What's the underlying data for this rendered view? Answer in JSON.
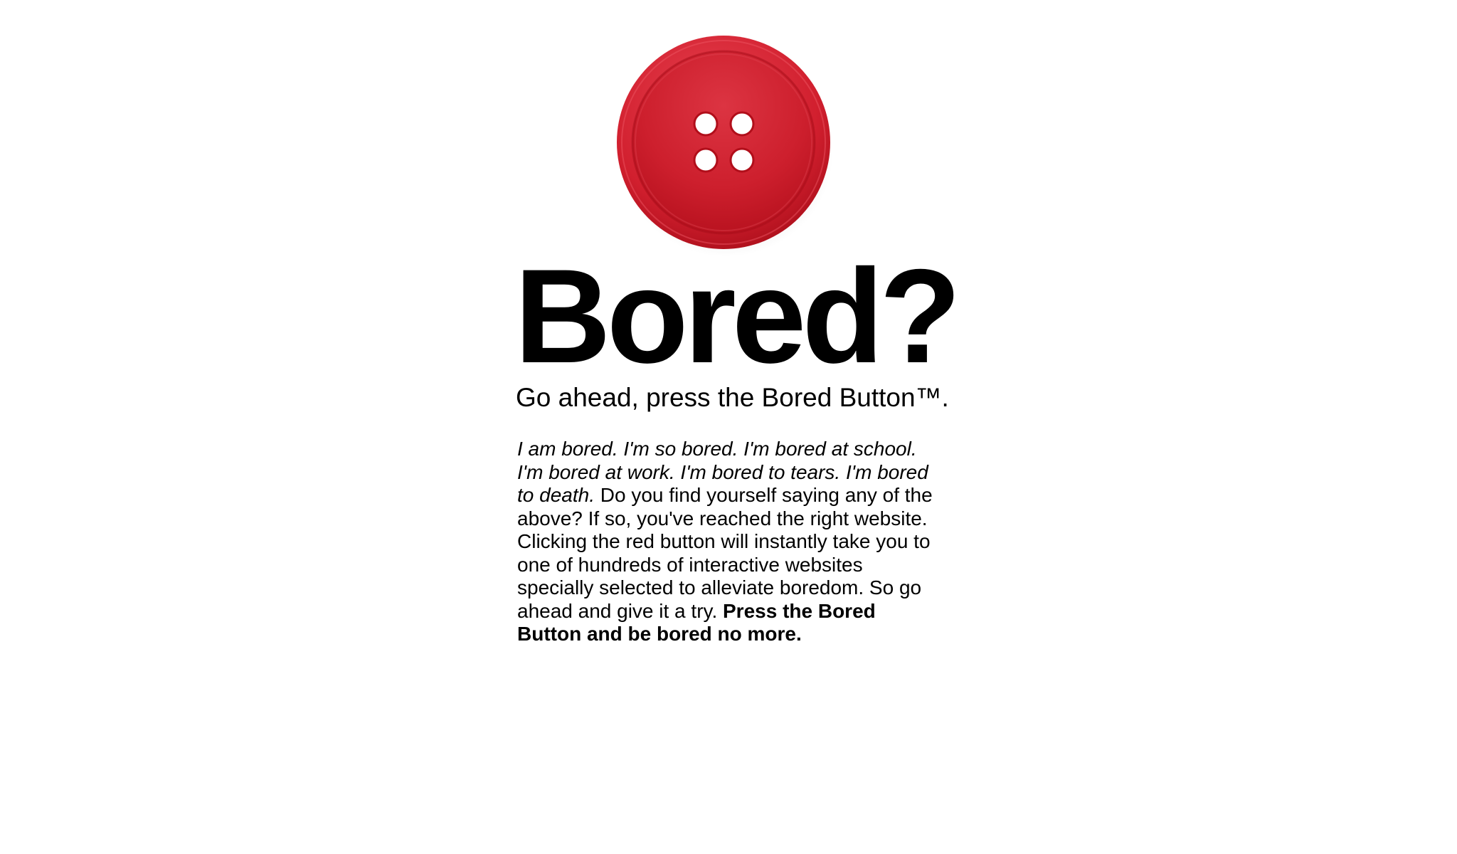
{
  "button": {
    "colors": {
      "main": "#d3202f",
      "dark": "#b20e1b",
      "light": "#e63947"
    }
  },
  "headline": "Bored?",
  "tagline": "Go ahead, press the Bored Button™.",
  "description": {
    "italic_intro": "I am bored. I'm so bored. I'm bored at school. I'm bored at work. I'm bored to tears. I'm bored to death.",
    "body": " Do you find yourself saying any of the above? If so, you've reached the right website. Clicking the red button will instantly take you to one of hundreds of interactive websites specially selected to alleviate boredom. So go ahead and give it a try. ",
    "bold_cta": "Press the Bored Button and be bored no more."
  }
}
